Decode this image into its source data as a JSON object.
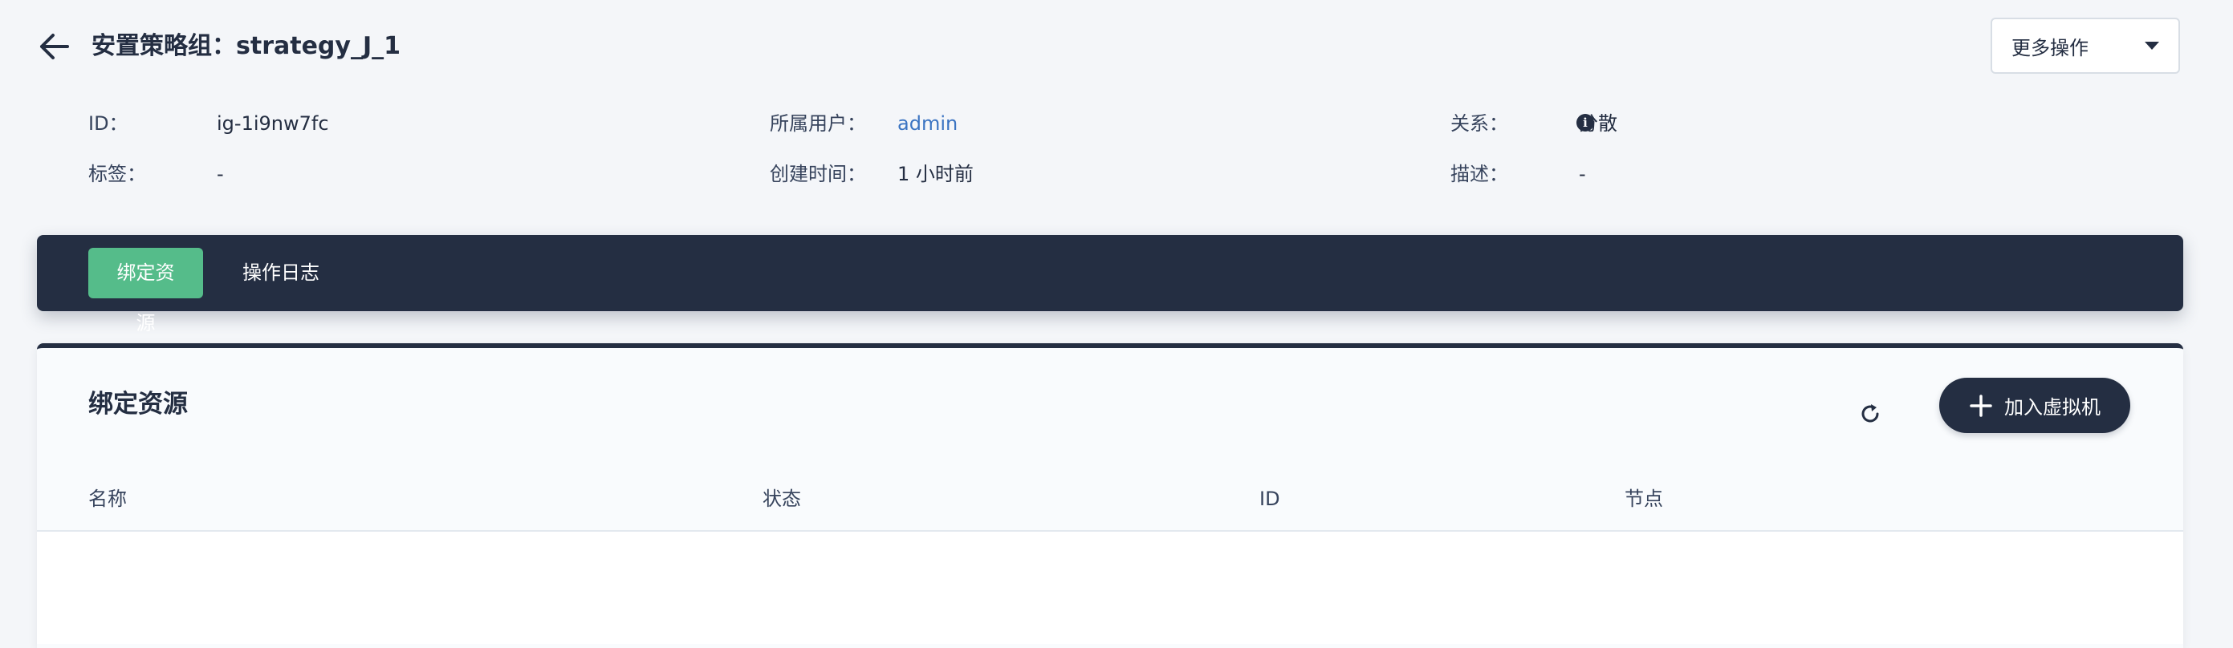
{
  "header": {
    "title": "安置策略组：strategy_J_1",
    "more_actions_label": "更多操作"
  },
  "details": {
    "id_label": "ID：",
    "id_value": "ig-1i9nw7fc",
    "owner_label": "所属用户：",
    "owner_value": "admin",
    "relation_label": "关系：",
    "relation_value": "分散",
    "tags_label": "标签：",
    "tags_value": "-",
    "created_label": "创建时间：",
    "created_value": "1 小时前",
    "desc_label": "描述：",
    "desc_value": "-"
  },
  "tabs": [
    {
      "label": "绑定资源",
      "active": true
    },
    {
      "label": "操作日志",
      "active": false
    }
  ],
  "panel": {
    "title": "绑定资源",
    "add_button_label": "加入虚拟机",
    "columns": [
      "名称",
      "状态",
      "ID",
      "节点"
    ],
    "rows": []
  },
  "icons": {
    "back": "arrow-left-icon",
    "caret": "caret-down-icon",
    "info": "info-icon",
    "refresh": "refresh-icon",
    "add": "plus-icon"
  },
  "colors": {
    "dark": "#242e42",
    "active_tab": "#55bc8a",
    "link": "#3b74c2",
    "background": "#f4f6f9"
  }
}
